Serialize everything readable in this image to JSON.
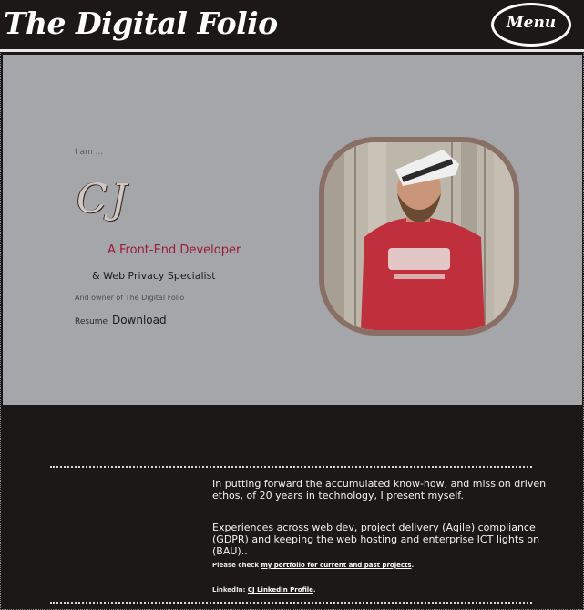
{
  "header": {
    "logo": "The Digital Folio",
    "menu_label": "Menu"
  },
  "hero": {
    "intro": "I am ...",
    "signature": "CJ",
    "role": "A Front-End Developer",
    "specialty": "& Web Privacy Specialist",
    "owner": "And owner of The Digital Folio",
    "resume_label": "Resume",
    "download_label": "Download"
  },
  "about": {
    "paragraph1": "In putting forward the accumulated know-how, and mission driven ethos, of 20 years in technology, I present myself.",
    "paragraph2": "Experiences across web dev, project delivery (Agile) compliance (GDPR) and keeping the web hosting and enterprise ICT lights on (BAU)..",
    "portfolio_prefix": "Please check",
    "portfolio_link": "my portfolio for current and past projects",
    "portfolio_suffix": ".",
    "linkedin_prefix": "LinkedIn:",
    "linkedin_link": "CJ LinkedIn Profile",
    "linkedin_suffix": "."
  },
  "colors": {
    "background": "#1b1817",
    "hero_background": "#a5a6aa",
    "accent": "#9b1b3a",
    "photo_border": "#8a6f66"
  }
}
